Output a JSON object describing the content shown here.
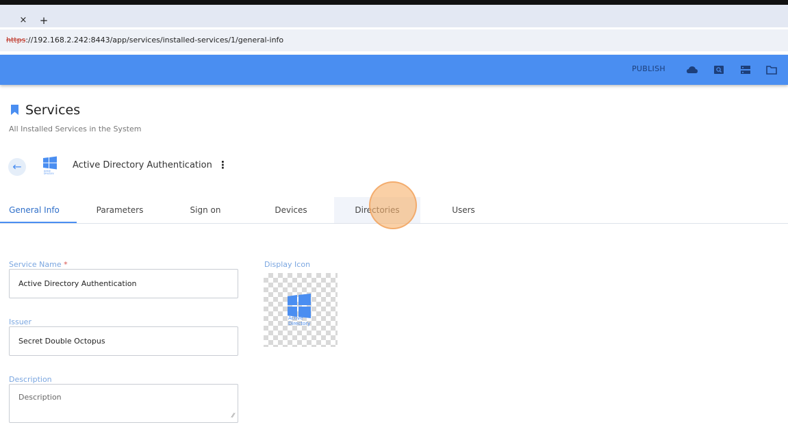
{
  "browser": {
    "tab_close": "×",
    "tab_new": "+",
    "url_scheme": "https",
    "url_rest": "://192.168.2.242:8443/app/services/installed-services/1/general-info"
  },
  "appbar": {
    "publish_label": "PUBLISH",
    "icons": [
      "cloud-icon",
      "search-icon",
      "server-icon",
      "folder-icon"
    ]
  },
  "header": {
    "title": "Services",
    "subtitle": "All Installed Services in the System"
  },
  "service": {
    "back_glyph": "←",
    "name": "Active Directory Authentication",
    "menu_glyph": "⋮",
    "icon_caption_line1": "Active",
    "icon_caption_line2": "Directory"
  },
  "tabs": [
    {
      "label": "General Info"
    },
    {
      "label": "Parameters"
    },
    {
      "label": "Sign on"
    },
    {
      "label": "Devices"
    },
    {
      "label": "Directories"
    },
    {
      "label": "Users"
    }
  ],
  "form": {
    "service_name_label": "Service Name",
    "required_mark": "*",
    "service_name_value": "Active Directory Authentication",
    "issuer_label": "Issuer",
    "issuer_value": "Secret Double Octopus",
    "description_label": "Description",
    "description_placeholder": "Description",
    "display_icon_label": "Display Icon"
  },
  "colors": {
    "accent": "#4a8ef1",
    "active_tab": "#2f6fc9",
    "label": "#7aa6e0",
    "required": "#d9534f"
  }
}
